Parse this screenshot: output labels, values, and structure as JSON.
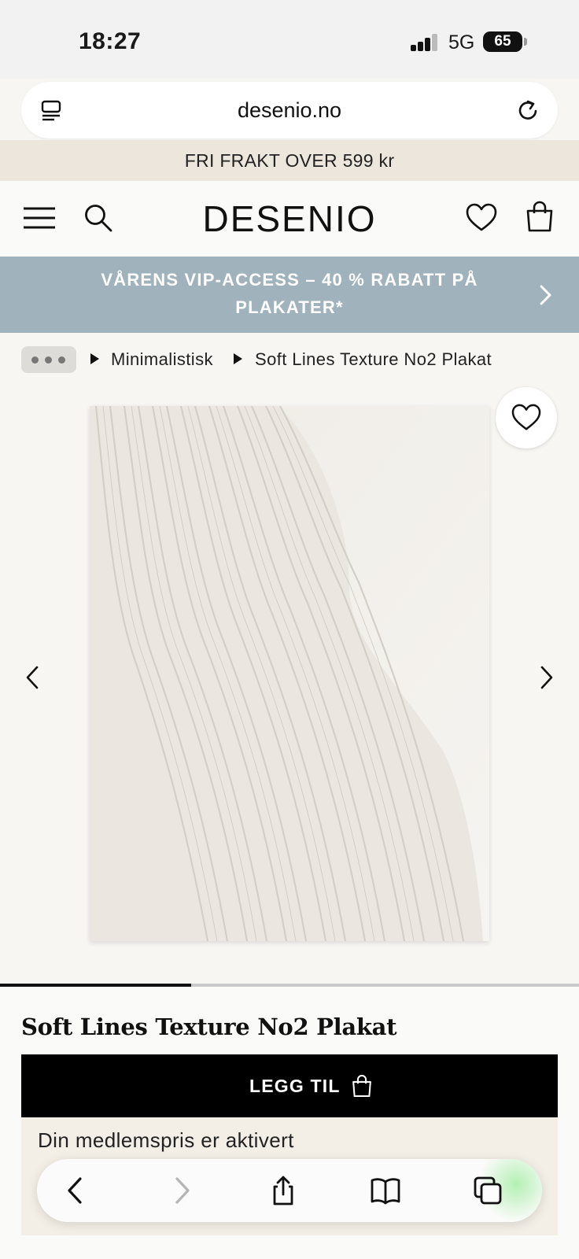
{
  "status_bar": {
    "time": "18:27",
    "network": "5G",
    "battery": "65"
  },
  "browser": {
    "url": "desenio.no"
  },
  "promo_strip": {
    "text": "FRI FRAKT OVER 599 kr"
  },
  "header": {
    "logo": "DESENIO",
    "icons": [
      "menu-icon",
      "search-icon",
      "heart-icon",
      "bag-icon"
    ]
  },
  "vip_banner": {
    "line1": "VÅRENS VIP-ACCESS – 40 % RABATT PÅ",
    "line2": "PLAKATER*",
    "background": "#a0b3bd"
  },
  "breadcrumb": {
    "items": [
      "Minimalistisk",
      "Soft Lines Texture No2 Plakat"
    ]
  },
  "gallery": {
    "slide_progress": 0.33
  },
  "product": {
    "title": "Soft Lines Texture No2 Plakat",
    "add_button": "LEGG TIL",
    "member_text": "Din medlemspris er aktivert"
  },
  "colors": {
    "accent": "#000000",
    "page_background": "#f7f6f3",
    "promo_background": "#ece6dc"
  }
}
